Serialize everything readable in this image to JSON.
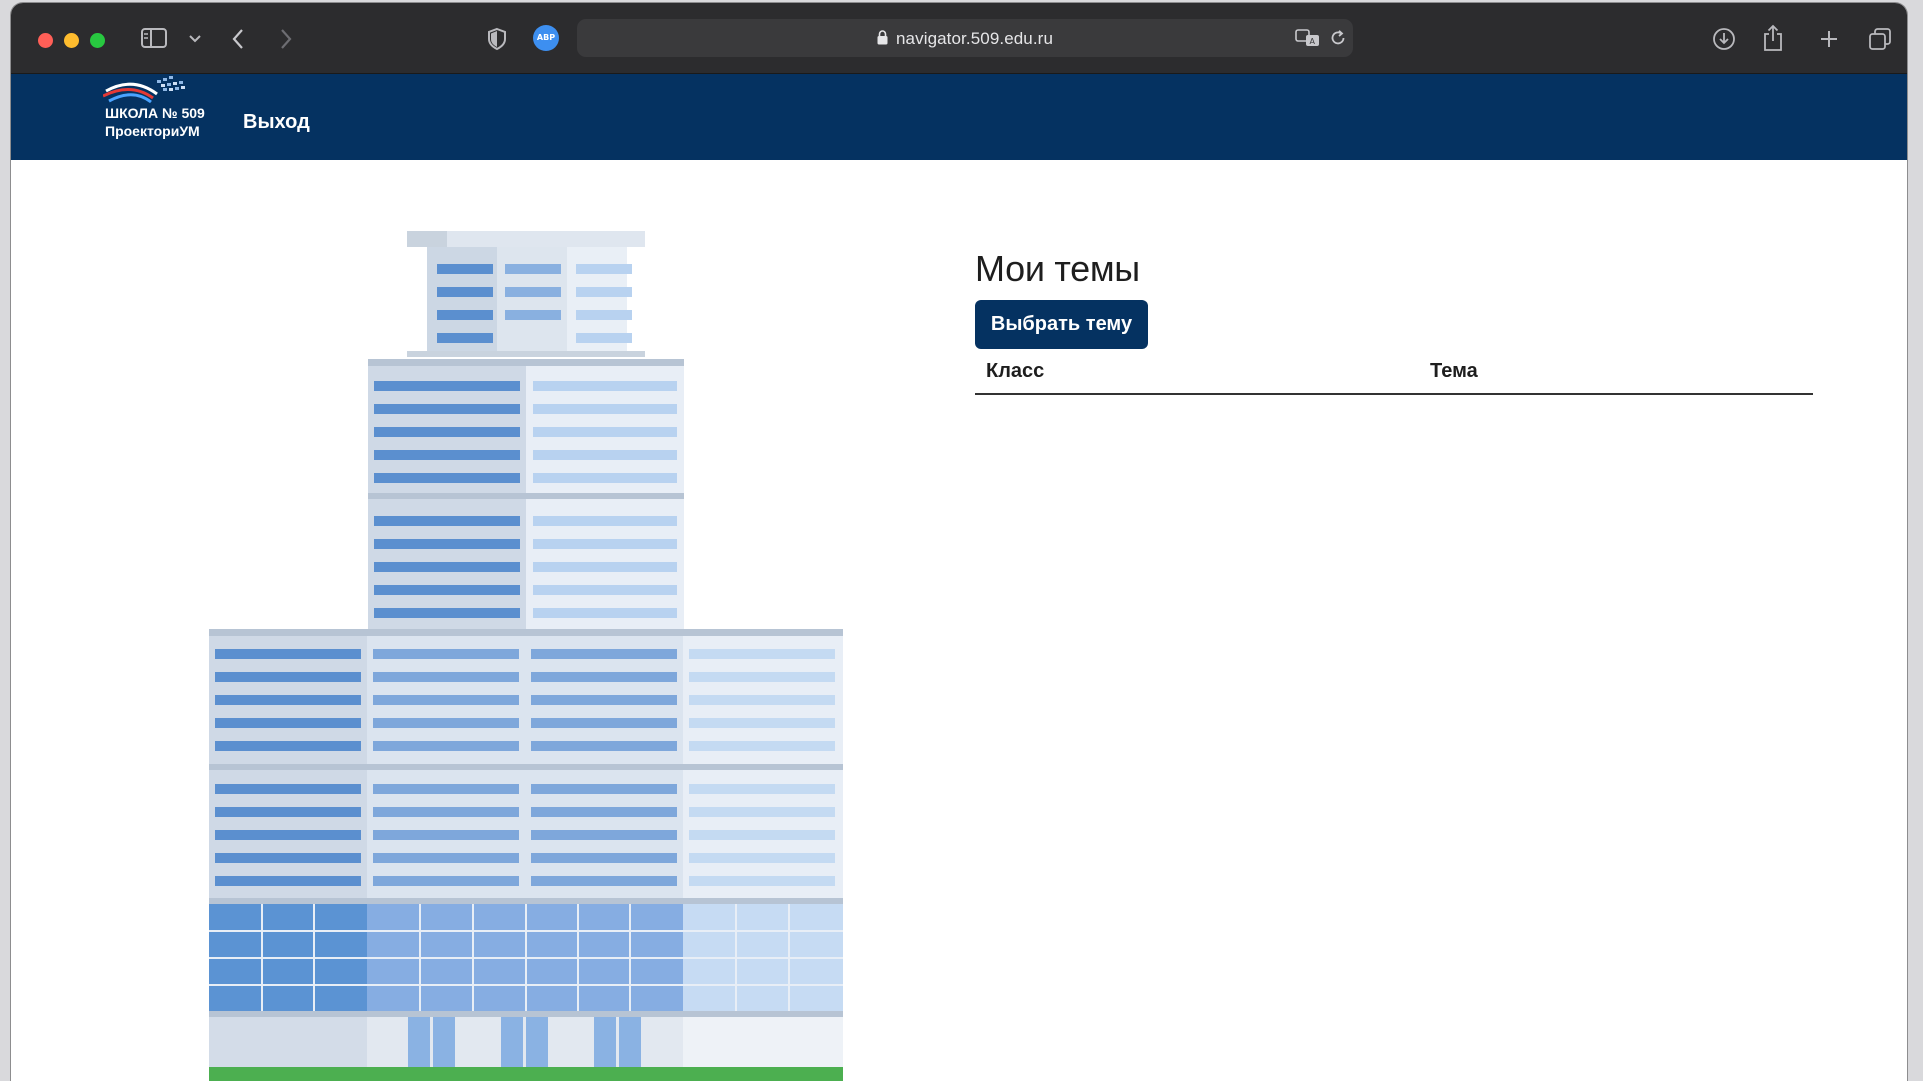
{
  "browser": {
    "url": "navigator.509.edu.ru",
    "abp_badge": "ABP"
  },
  "navbar": {
    "logo_line1": "ШКОЛА № 509",
    "logo_line2": "ПроекториУМ",
    "logout_label": "Выход"
  },
  "topics": {
    "heading": "Мои темы",
    "choose_button": "Выбрать тему",
    "columns": [
      "Класс",
      "Тема"
    ]
  },
  "colors": {
    "navbar": "#053261",
    "button": "#053261",
    "titlebar": "#2c2c2e"
  }
}
